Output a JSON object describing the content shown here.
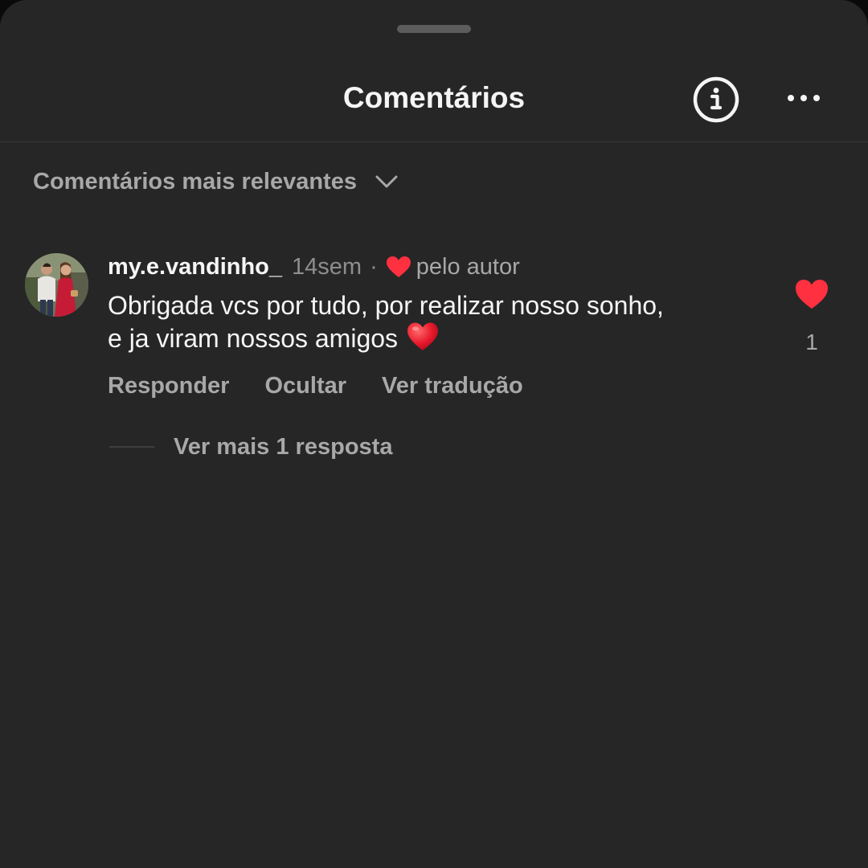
{
  "colors": {
    "sheet_background": "#262626",
    "primary_text": "#f5f5f5",
    "secondary_text": "#a8a8a8",
    "like_red": "#ff3040"
  },
  "header": {
    "title": "Comentários",
    "info_icon": "info-circle-icon",
    "more_icon": "more-horizontal-icon"
  },
  "sort": {
    "label": "Comentários mais relevantes",
    "icon": "chevron-down-icon"
  },
  "comment": {
    "username": "my.e.vandinho_",
    "timestamp": "14sem",
    "separator": "·",
    "liked_by_author": "pelo autor",
    "text_line1": "Obrigada vcs por tudo, por realizar nosso sonho,",
    "text_line2": "e ja viram nossos amigos",
    "emoji": "red-heart-emoji",
    "like_count": "1",
    "liked": true,
    "actions": {
      "reply": "Responder",
      "hide": "Ocultar",
      "translate": "Ver tradução"
    },
    "view_replies": "Ver mais 1 resposta"
  }
}
